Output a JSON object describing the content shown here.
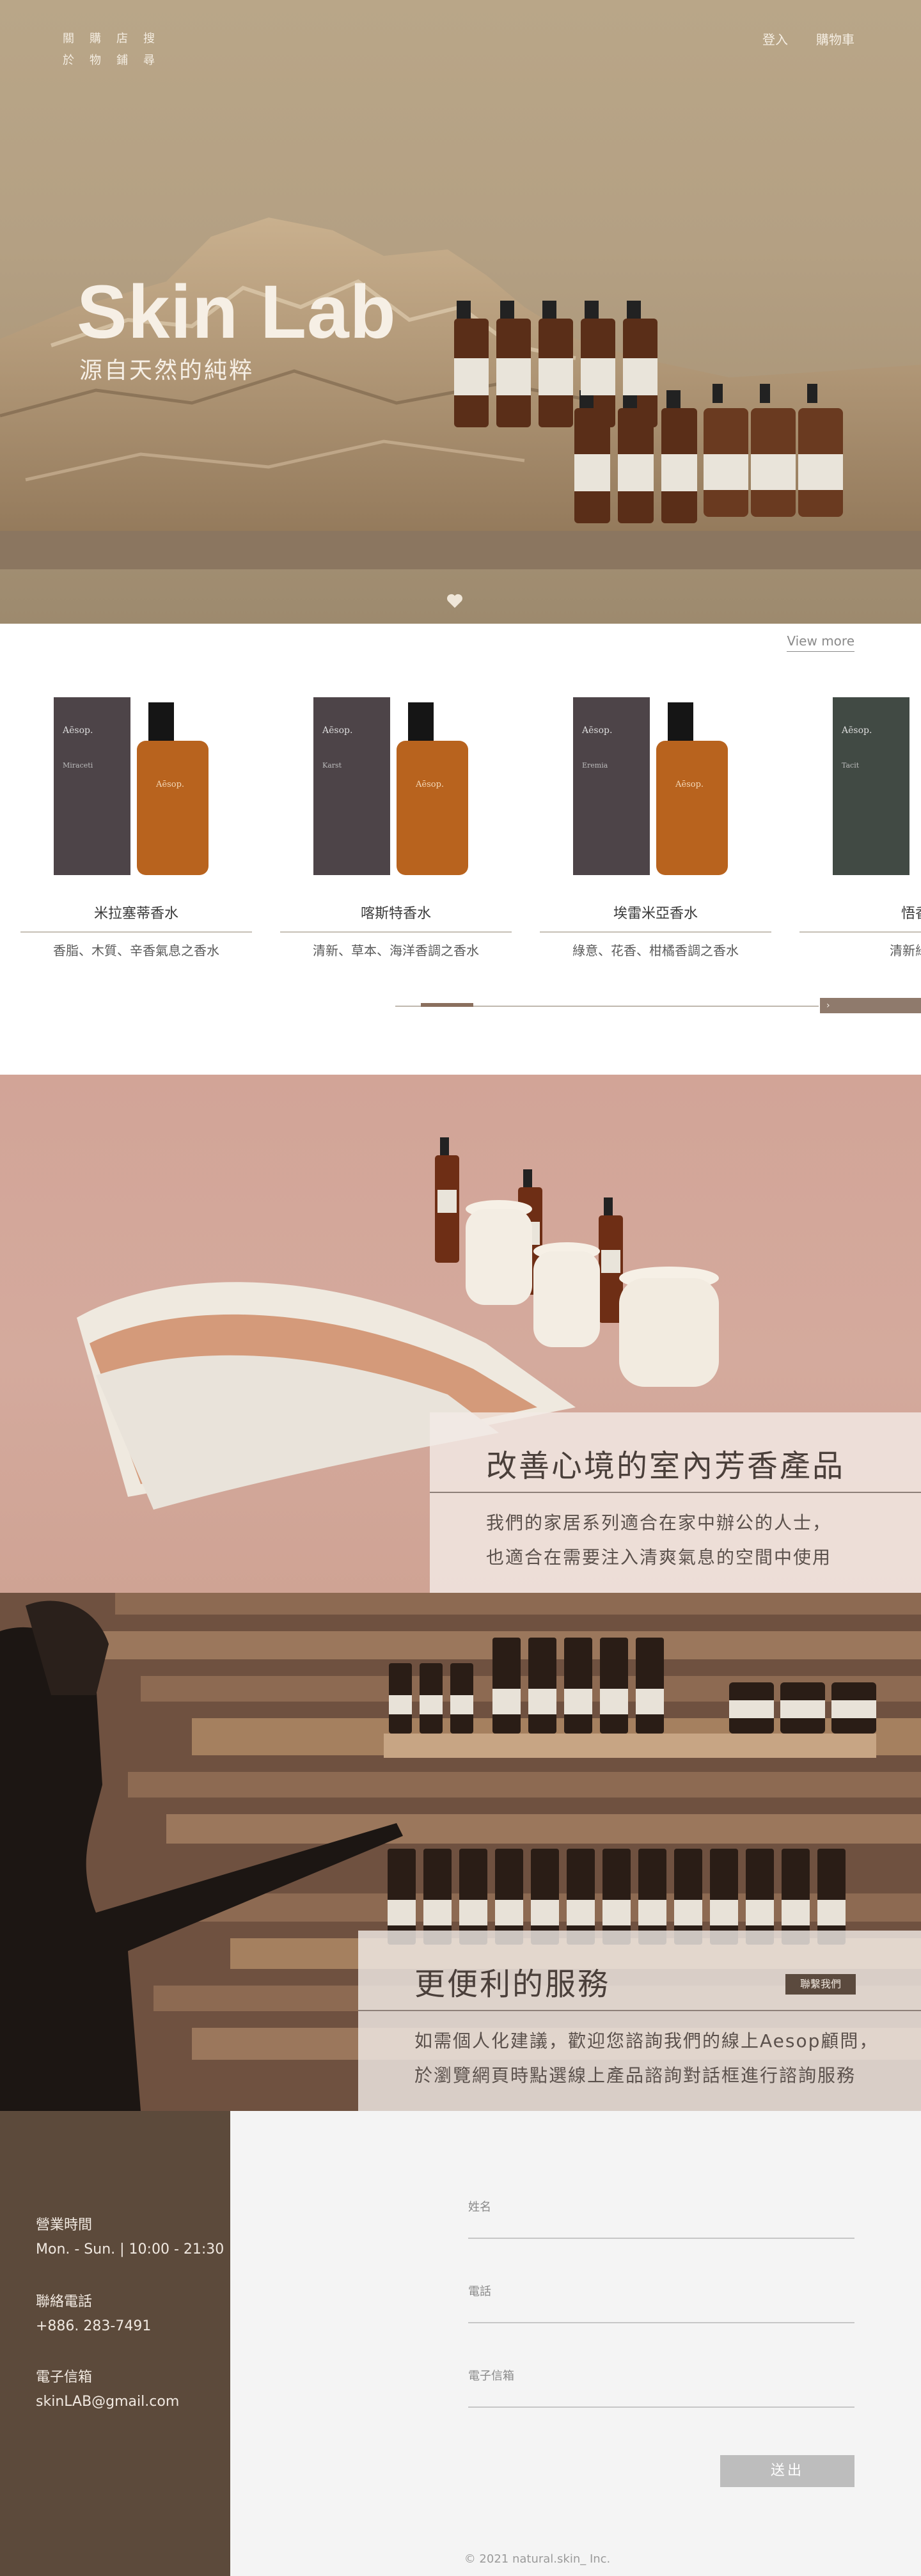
{
  "nav": {
    "left_col1": [
      "關",
      "於"
    ],
    "left_col2": [
      "購",
      "物"
    ],
    "left_col3": [
      "店",
      "鋪"
    ],
    "left_col4": [
      "搜",
      "尋"
    ],
    "login": "登入",
    "cart": "購物車"
  },
  "hero": {
    "title": "Skin Lab",
    "subtitle": "源自天然的純粹"
  },
  "products": {
    "view_more": "View more",
    "items": [
      {
        "name": "米拉塞蒂香水",
        "desc": "香脂、木質、辛香氣息之香水",
        "box": "#4d4448",
        "label": "Miraceti"
      },
      {
        "name": "喀斯特香水",
        "desc": "清新、草本、海洋香調之香水",
        "box": "#4d4448",
        "label": "Karst"
      },
      {
        "name": "埃雷米亞香水",
        "desc": "綠意、花香、柑橘香調之香水",
        "box": "#4d4448",
        "label": "Eremia"
      },
      {
        "name": "悟香",
        "desc": "清新綠色",
        "box": "#414a44",
        "label": "Tacit"
      }
    ],
    "brand": "Aēsop.",
    "next_glyph": "›"
  },
  "home": {
    "title": "改善心境的室內芳香產品",
    "desc_line1": "我們的家居系列適合在家中辦公的人士，",
    "desc_line2": "也適合在需要注入清爽氣息的空間中使用"
  },
  "service": {
    "title": "更便利的服務",
    "contact": "聯繫我們",
    "desc_line1": "如需個人化建議，歡迎您諮詢我們的線上Aesop顧問，",
    "desc_line2": "於瀏覽網頁時點選線上產品諮詢對話框進行諮詢服務"
  },
  "info": {
    "hours_label": "營業時間",
    "hours": "Mon. - Sun. | 10:00 - 21:30",
    "phone_label": "聯絡電話",
    "phone": "+886. 283-7491",
    "email_label": "電子信箱",
    "email": "skinLAB@gmail.com"
  },
  "form": {
    "name_label": "姓名",
    "phone_label": "電話",
    "email_label": "電子信箱",
    "submit": "送出",
    "copyright": "© 2021 natural.skin_ Inc."
  },
  "colors": {
    "accent": "#8a6f5e",
    "footer_brown": "#5c4a3b"
  }
}
